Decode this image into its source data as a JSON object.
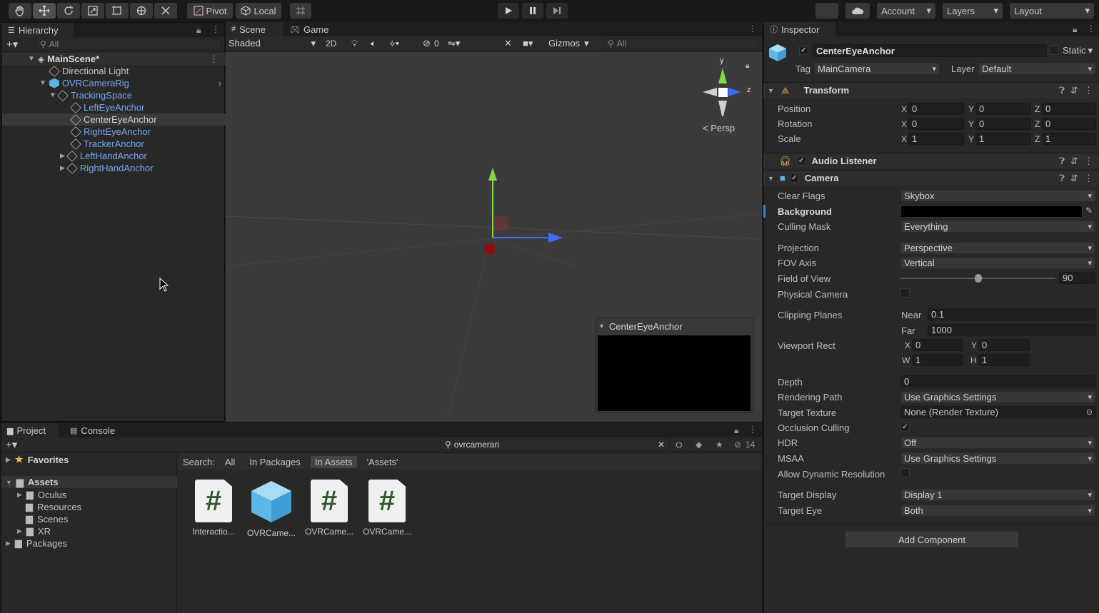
{
  "toolbar": {
    "pivot": "Pivot",
    "local": "Local",
    "account": "Account",
    "layers": "Layers",
    "layout": "Layout"
  },
  "hierarchy": {
    "tab": "Hierarchy",
    "search_placeholder": "All",
    "items": [
      {
        "label": "MainScene*"
      },
      {
        "label": "Directional Light"
      },
      {
        "label": "OVRCameraRig"
      },
      {
        "label": "TrackingSpace"
      },
      {
        "label": "LeftEyeAnchor"
      },
      {
        "label": "CenterEyeAnchor"
      },
      {
        "label": "RightEyeAnchor"
      },
      {
        "label": "TrackerAnchor"
      },
      {
        "label": "LeftHandAnchor"
      },
      {
        "label": "RightHandAnchor"
      }
    ]
  },
  "scene": {
    "tab_scene": "Scene",
    "tab_game": "Game",
    "shading": "Shaded",
    "mode_2d": "2D",
    "hidden_count": "0",
    "gizmos": "Gizmos",
    "search_placeholder": "All",
    "persp": "< Persp",
    "axis_y": "y",
    "axis_z": "z",
    "preview_title": "CenterEyeAnchor"
  },
  "project": {
    "tab_project": "Project",
    "tab_console": "Console",
    "search_value": "ovrcamerari",
    "hidden_count": "14",
    "favorites": "Favorites",
    "assets": "Assets",
    "folders": [
      "Oculus",
      "Resources",
      "Scenes",
      "XR"
    ],
    "packages": "Packages",
    "search_label": "Search:",
    "filters": [
      "All",
      "In Packages",
      "In Assets",
      "'Assets'"
    ],
    "items": [
      "Interactio...",
      "OVRCame...",
      "OVRCame...",
      "OVRCame..."
    ]
  },
  "inspector": {
    "tab": "Inspector",
    "object_name": "CenterEyeAnchor",
    "static": "Static",
    "tag_label": "Tag",
    "tag_value": "MainCamera",
    "layer_label": "Layer",
    "layer_value": "Default",
    "transform": {
      "title": "Transform",
      "position_label": "Position",
      "rotation_label": "Rotation",
      "scale_label": "Scale",
      "position": [
        "0",
        "0",
        "0"
      ],
      "rotation": [
        "0",
        "0",
        "0"
      ],
      "scale": [
        "1",
        "1",
        "1"
      ],
      "x": "X",
      "y": "Y",
      "z": "Z"
    },
    "audio_listener": "Audio Listener",
    "camera": {
      "title": "Camera",
      "clear_flags_label": "Clear Flags",
      "clear_flags": "Skybox",
      "background_label": "Background",
      "culling_mask_label": "Culling Mask",
      "culling_mask": "Everything",
      "projection_label": "Projection",
      "projection": "Perspective",
      "fov_axis_label": "FOV Axis",
      "fov_axis": "Vertical",
      "fov_label": "Field of View",
      "fov_value": "90",
      "fov_fraction": 0.5,
      "physical_label": "Physical Camera",
      "clipping_label": "Clipping Planes",
      "near_label": "Near",
      "near": "0.1",
      "far_label": "Far",
      "far": "1000",
      "viewport_label": "Viewport Rect",
      "vx": "0",
      "vy": "0",
      "vw": "1",
      "vh": "1",
      "w": "W",
      "h": "H",
      "depth_label": "Depth",
      "depth": "0",
      "rendering_path_label": "Rendering Path",
      "rendering_path": "Use Graphics Settings",
      "target_texture_label": "Target Texture",
      "target_texture": "None (Render Texture)",
      "occlusion_label": "Occlusion Culling",
      "hdr_label": "HDR",
      "hdr": "Off",
      "msaa_label": "MSAA",
      "msaa": "Use Graphics Settings",
      "dynres_label": "Allow Dynamic Resolution",
      "target_display_label": "Target Display",
      "target_display": "Display 1",
      "target_eye_label": "Target Eye",
      "target_eye": "Both"
    },
    "add_component": "Add Component"
  },
  "colors": {
    "accent_blue": "#7ba7ee",
    "gizmo_y": "#7fd84a",
    "gizmo_x": "#d04040",
    "gizmo_z": "#3f6dff"
  }
}
